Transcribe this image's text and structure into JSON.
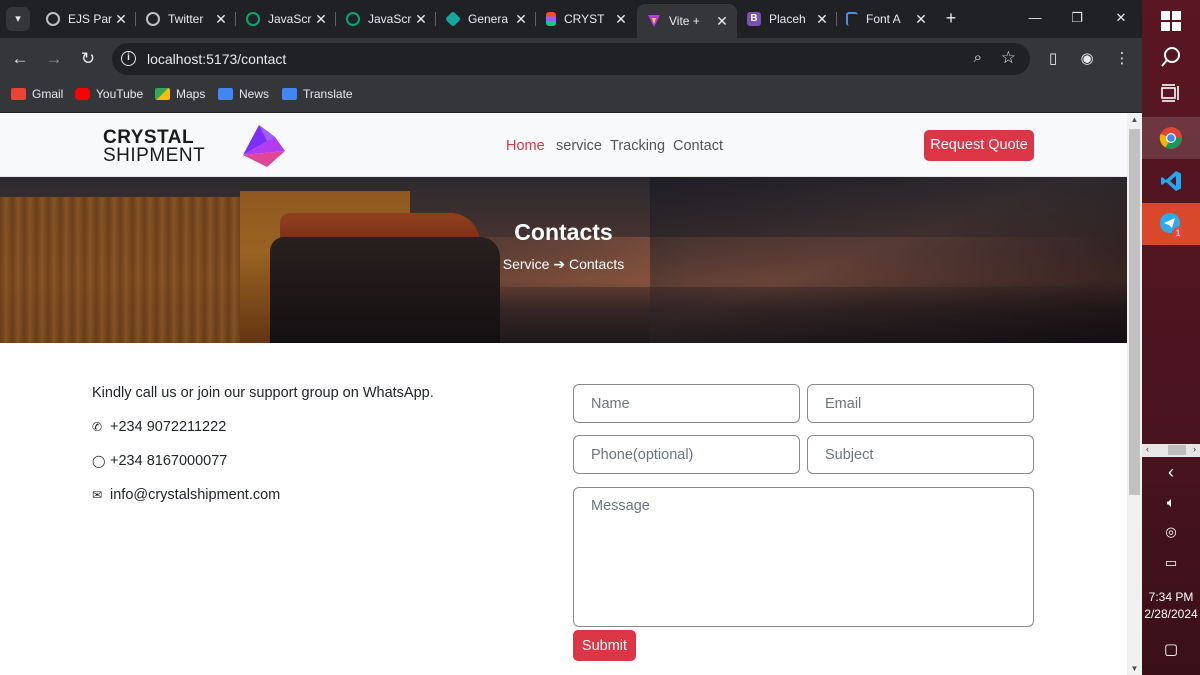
{
  "tabs": [
    {
      "label": "EJS Par",
      "icon": "globe-icon",
      "color": "#bdc1c6"
    },
    {
      "label": "Twitter",
      "icon": "globe-icon",
      "color": "#bdc1c6"
    },
    {
      "label": "JavaScr",
      "icon": "w3schools-icon",
      "color": "#04aa6d"
    },
    {
      "label": "JavaScr",
      "icon": "w3schools-icon",
      "color": "#04aa6d"
    },
    {
      "label": "Genera",
      "icon": "diamond-icon",
      "color": "#13a89e"
    },
    {
      "label": "CRYST",
      "icon": "figma-icon",
      "color": "#f24e1e"
    },
    {
      "label": "Vite +",
      "icon": "vite-icon",
      "color": "#bd34fe",
      "active": true
    },
    {
      "label": "Placeh",
      "icon": "bootstrap-icon",
      "color": "#7952b3"
    },
    {
      "label": "Font A",
      "icon": "flag-icon",
      "color": "#528dd7"
    }
  ],
  "address": {
    "url": "localhost:5173/contact"
  },
  "bookmarks": [
    {
      "label": "Gmail",
      "color": "#ea4335"
    },
    {
      "label": "YouTube",
      "color": "#ff0000"
    },
    {
      "label": "Maps",
      "color": "#34a853"
    },
    {
      "label": "News",
      "color": "#4285f4"
    },
    {
      "label": "Translate",
      "color": "#4285f4"
    }
  ],
  "site": {
    "logo_line1": "CRYSTAL",
    "logo_line2": "SHIPMENT",
    "nav": [
      "Home",
      "service",
      "Tracking",
      "Contact"
    ],
    "quote_button": "Request Quote",
    "accent": "#dc3545"
  },
  "hero": {
    "title": "Contacts",
    "crumb_from": "Service",
    "crumb_to": "Contacts"
  },
  "contact": {
    "intro": "Kindly call us or join our support group on WhatsApp.",
    "phone": "+234 9072211222",
    "whatsapp": "+234 8167000077",
    "email": "info@crystalshipment.com"
  },
  "form": {
    "name_placeholder": "Name",
    "email_placeholder": "Email",
    "phone_placeholder": "Phone(optional)",
    "subject_placeholder": "Subject",
    "message_placeholder": "Message",
    "submit_label": "Submit"
  },
  "taskbar": {
    "time": "7:34 PM",
    "date": "2/28/2024",
    "telegram_badge": "1"
  }
}
